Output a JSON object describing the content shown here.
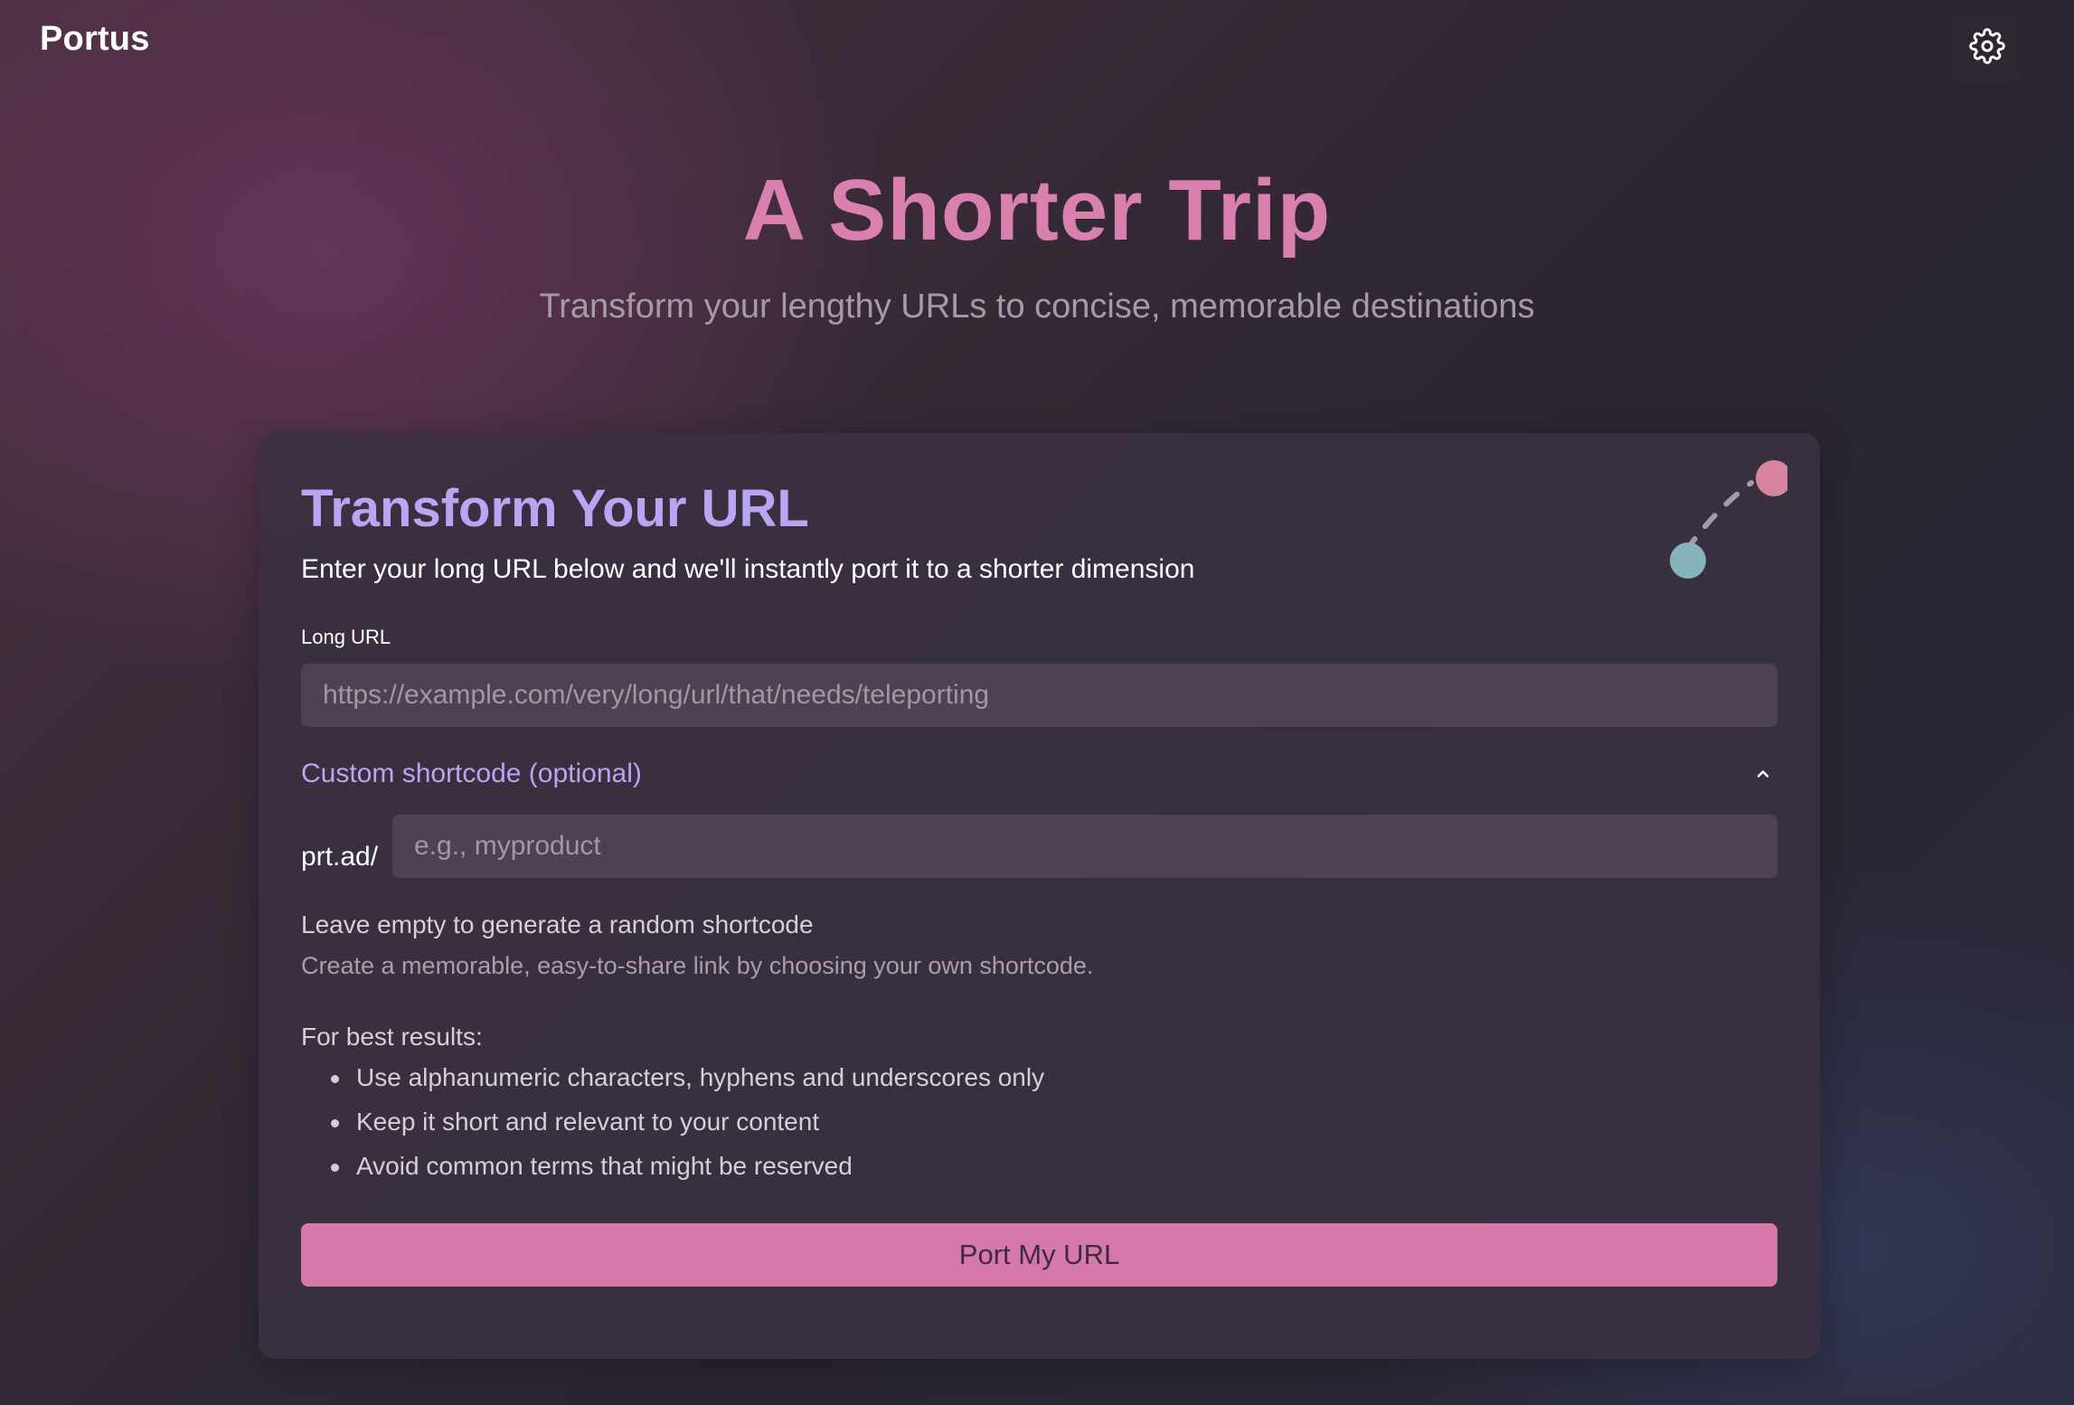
{
  "header": {
    "brand": "Portus",
    "settings_icon": "gear-icon"
  },
  "hero": {
    "title": "A Shorter Trip",
    "subtitle": "Transform your lengthy URLs to concise, memorable destinations"
  },
  "card": {
    "title": "Transform Your URL",
    "description": "Enter your long URL below and we'll instantly port it to a shorter dimension",
    "graphic_icon": "teleport-dots-icon",
    "long_url": {
      "label": "Long URL",
      "value": "",
      "placeholder": "https://example.com/very/long/url/that/needs/teleporting"
    },
    "custom": {
      "toggle_label": "Custom shortcode (optional)",
      "toggle_icon": "chevron-up-icon",
      "expanded": true,
      "prefix": "prt.ad/",
      "value": "",
      "placeholder": "e.g., myproduct",
      "help_primary": "Leave empty to generate a random shortcode",
      "help_secondary": "Create a memorable, easy-to-share link by choosing your own shortcode.",
      "tips_heading": "For best results:",
      "tips": [
        "Use alphanumeric characters, hyphens and underscores only",
        "Keep it short and relevant to your content",
        "Avoid common terms that might be reserved"
      ]
    },
    "submit_label": "Port My URL"
  },
  "colors": {
    "accent_pink": "#d980af",
    "accent_lavender": "#b8a6f2",
    "button_pink": "#d678aa",
    "dot_pink": "#d9849f",
    "dot_teal": "#86b3bc"
  }
}
